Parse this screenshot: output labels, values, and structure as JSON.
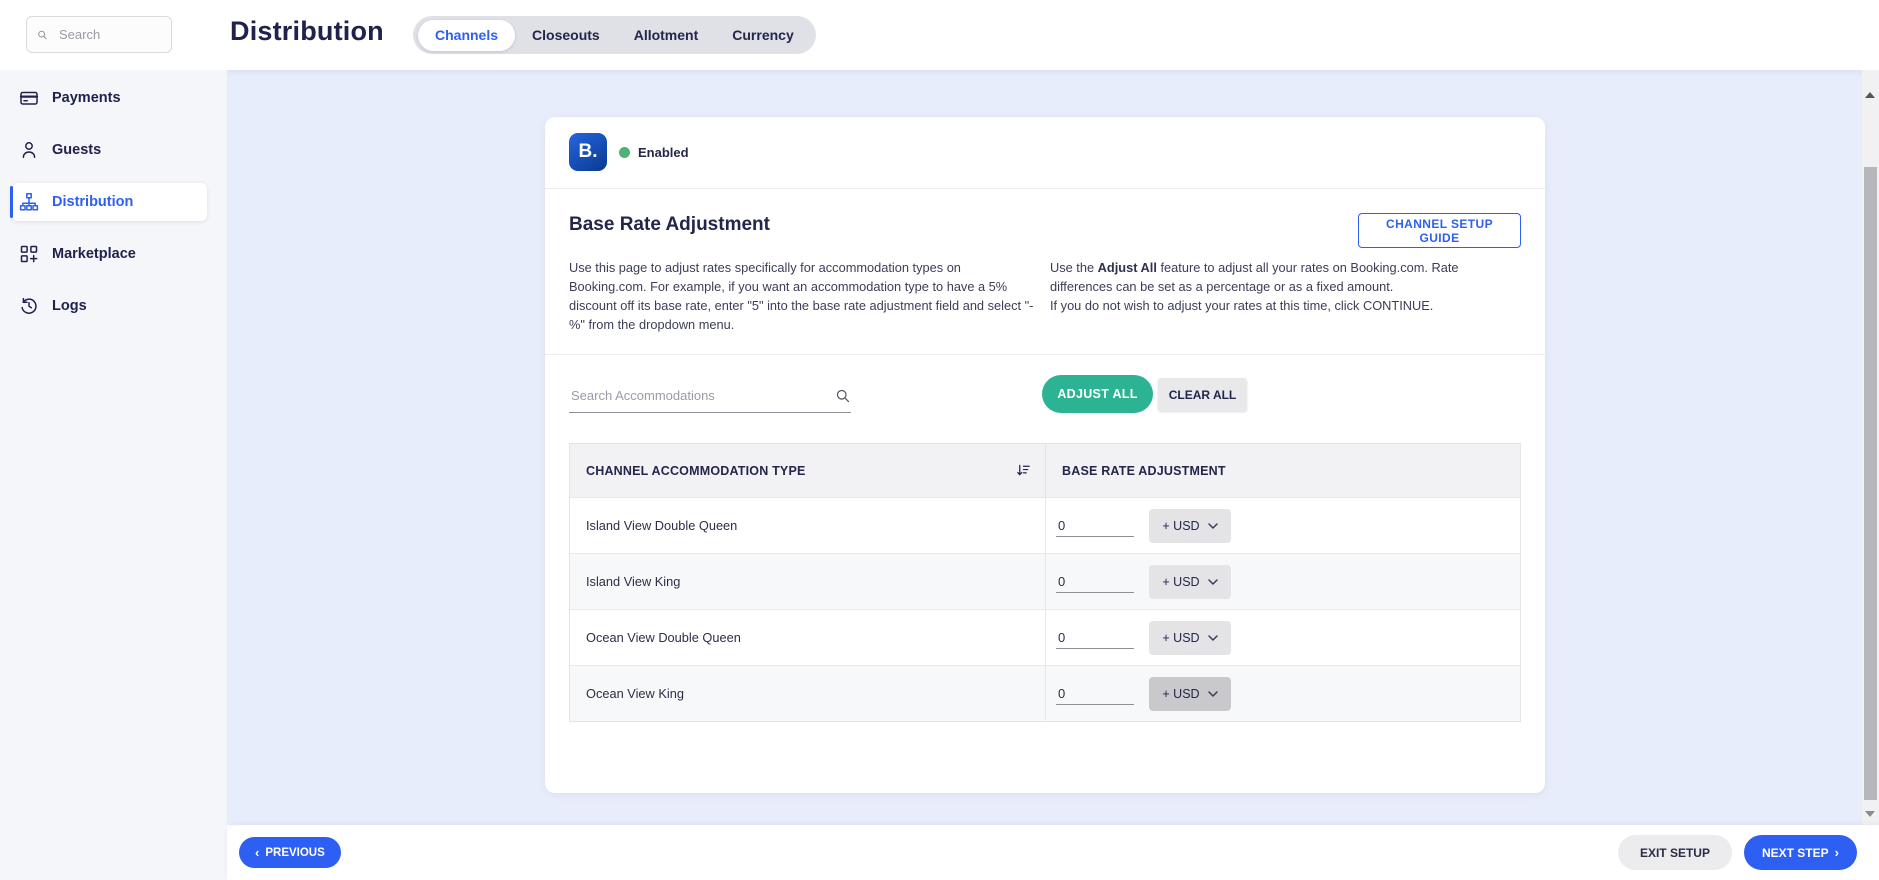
{
  "topbar": {
    "search_placeholder": "Search",
    "title": "Distribution",
    "tabs": [
      {
        "label": "Channels",
        "active": true
      },
      {
        "label": "Closeouts",
        "active": false
      },
      {
        "label": "Allotment",
        "active": false
      },
      {
        "label": "Currency",
        "active": false
      }
    ]
  },
  "sidebar": {
    "items": [
      {
        "label": "Payments",
        "icon": "credit-card-icon",
        "active": false
      },
      {
        "label": "Guests",
        "icon": "person-icon",
        "active": false
      },
      {
        "label": "Distribution",
        "icon": "sitemap-icon",
        "active": true
      },
      {
        "label": "Marketplace",
        "icon": "grid-plus-icon",
        "active": false
      },
      {
        "label": "Logs",
        "icon": "history-icon",
        "active": false
      }
    ]
  },
  "channel_card": {
    "logo_text": "B.",
    "status": "Enabled",
    "section": {
      "heading": "Base Rate Adjustment",
      "guide_button": "CHANNEL SETUP GUIDE",
      "desc_left": "Use this page to adjust rates specifically for accommodation types on Booking.com. For example, if you want an accommodation type to have a 5% discount off its base rate, enter \"5\" into the base rate adjustment field and select \"-%\" from the dropdown menu.",
      "desc_right_prefix": "Use the ",
      "desc_right_bold": "Adjust All",
      "desc_right_suffix": " feature to adjust all your rates on Booking.com. Rate differences can be set as a percentage or as a fixed amount.",
      "desc_right_line2": "If you do not wish to adjust your rates at this time, click CONTINUE."
    },
    "toolbar": {
      "search_placeholder": "Search Accommodations",
      "adjust_all_label": "ADJUST ALL",
      "clear_all_label": "CLEAR ALL"
    },
    "table": {
      "col1": "CHANNEL ACCOMMODATION TYPE",
      "col2": "BASE RATE ADJUSTMENT",
      "rows": [
        {
          "name": "Island View Double Queen",
          "value": "0",
          "unit": "+ USD"
        },
        {
          "name": "Island View King",
          "value": "0",
          "unit": "+ USD"
        },
        {
          "name": "Ocean View Double Queen",
          "value": "0",
          "unit": "+ USD"
        },
        {
          "name": "Ocean View King",
          "value": "0",
          "unit": "+ USD"
        }
      ]
    }
  },
  "footer": {
    "previous_label": "PREVIOUS",
    "exit_label": "EXIT SETUP",
    "next_label": "NEXT STEP"
  },
  "icons": {
    "chevron_left": "‹",
    "chevron_right": "›"
  },
  "colors": {
    "accent_blue": "#2d5ff2",
    "adjust_green": "#2cb394",
    "status_green": "#4db374",
    "navy": "#23254b",
    "content_bg": "#e8edfb"
  }
}
